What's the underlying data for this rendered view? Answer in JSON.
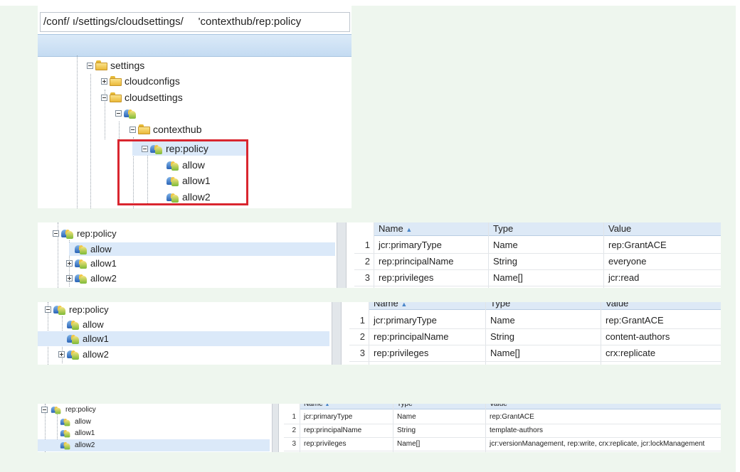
{
  "path": {
    "value": "/conf/ ı/settings/cloudsettings/     'contexthub/rep:policy"
  },
  "tree1": {
    "settings": "settings",
    "cloudconfigs": "cloudconfigs",
    "cloudsettings": "cloudsettings",
    "contexthub": "contexthub",
    "policy": "rep:policy",
    "allow": "allow",
    "allow1": "allow1",
    "allow2": "allow2"
  },
  "columns": {
    "name": "Name",
    "type": "Type",
    "value": "Value",
    "sort_indicator": "▲"
  },
  "panels": [
    {
      "tree": [
        "rep:policy",
        "allow",
        "allow1",
        "allow2"
      ],
      "selected": "allow",
      "rows": [
        {
          "n": "1",
          "name": "jcr:primaryType",
          "type": "Name",
          "value": "rep:GrantACE"
        },
        {
          "n": "2",
          "name": "rep:principalName",
          "type": "String",
          "value": "everyone"
        },
        {
          "n": "3",
          "name": "rep:privileges",
          "type": "Name[]",
          "value": "jcr:read"
        }
      ]
    },
    {
      "tree": [
        "rep:policy",
        "allow",
        "allow1",
        "allow2"
      ],
      "selected": "allow1",
      "rows": [
        {
          "n": "1",
          "name": "jcr:primaryType",
          "type": "Name",
          "value": "rep:GrantACE"
        },
        {
          "n": "2",
          "name": "rep:principalName",
          "type": "String",
          "value": "content-authors"
        },
        {
          "n": "3",
          "name": "rep:privileges",
          "type": "Name[]",
          "value": "crx:replicate"
        }
      ]
    },
    {
      "tree": [
        "rep:policy",
        "allow",
        "allow1",
        "allow2"
      ],
      "selected": "allow2",
      "rows": [
        {
          "n": "1",
          "name": "jcr:primaryType",
          "type": "Name",
          "value": "rep:GrantACE"
        },
        {
          "n": "2",
          "name": "rep:principalName",
          "type": "String",
          "value": "template-authors"
        },
        {
          "n": "3",
          "name": "rep:privileges",
          "type": "Name[]",
          "value": "jcr:versionManagement, rep:write, crx:replicate, jcr:lockManagement"
        }
      ]
    }
  ],
  "colors": {
    "selection": "#dbe9f9",
    "highlight_box": "#d9262f",
    "background": "#eef6ee"
  },
  "icons": [
    "folder-icon",
    "principal-node-icon",
    "expand-icon",
    "collapse-icon"
  ]
}
